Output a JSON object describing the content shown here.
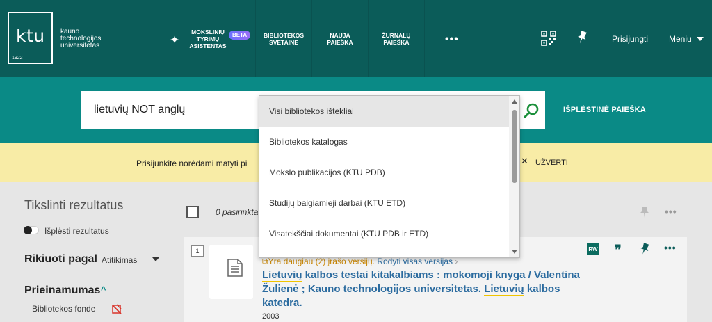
{
  "header": {
    "logo_text": "ktu",
    "logo_year": "1922",
    "university_lines": [
      "kauno",
      "technologijos",
      "universitetas"
    ],
    "nav": [
      {
        "lines": [
          "MOKSLINIŲ",
          "TYRIMŲ",
          "ASISTENTAS"
        ],
        "badge": "BETA"
      },
      {
        "lines": [
          "BIBLIOTEKOS",
          "SVETAINĖ"
        ]
      },
      {
        "lines": [
          "NAUJA",
          "PAIEŠKA"
        ]
      },
      {
        "lines": [
          "ŽURNALŲ",
          "PAIEŠKA"
        ]
      }
    ],
    "more": "•••",
    "signin": "Prisijungti",
    "menu": "Meniu"
  },
  "search": {
    "query": "lietuvių NOT anglų",
    "advanced": "IŠPLĖSTINĖ PAIEŠKA",
    "scope_options": [
      "Visi bibliotekos ištekliai",
      "Bibliotekos katalogas",
      "Mokslo publikacijos (KTU PDB)",
      "Studijų baigiamieji darbai (KTU ETD)",
      "Visatekščiai dokumentai (KTU PDB ir ETD)"
    ],
    "scope_selected_index": 0
  },
  "banner": {
    "text": "Prisijunkite norėdami matyti pi",
    "close_label": "UŽVERTI"
  },
  "facets": {
    "refine_title": "Tikslinti rezultatus",
    "expand_label": "Išplėsti rezultatus",
    "sort_label": "Rikiuoti pagal",
    "sort_value": "Atitikimas",
    "availability_label": "Prieinamumas",
    "availability_items": [
      "Bibliotekos fonde"
    ]
  },
  "results": {
    "selected_count": "0 pasirinkta",
    "records": [
      {
        "number": "1",
        "versions_text": "Yra daugiau (2) įrašo versijų.",
        "versions_link": "Rodyti visas versijas",
        "title_parts": [
          {
            "text": "Lietuvių",
            "highlight": true
          },
          {
            "text": " kalbos testai kitakalbiams : mokomoji knyga / Valentina Žulienė ; Kauno technologijos universitetas. ",
            "highlight": false
          },
          {
            "text": "Lietuvių",
            "highlight": true
          },
          {
            "text": " kalbos katedra.",
            "highlight": false
          }
        ],
        "year": "2003",
        "rw_badge": "RW",
        "quote": "❞"
      }
    ]
  }
}
